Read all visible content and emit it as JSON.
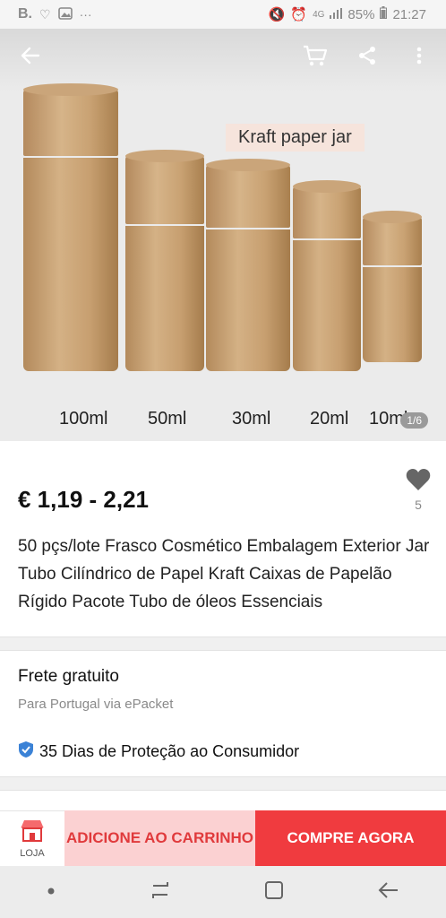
{
  "status_bar": {
    "carrier_mark": "B.",
    "battery": "85%",
    "time": "21:27",
    "network": "4G"
  },
  "hero": {
    "label": "Kraft paper jar",
    "volumes": [
      "100ml",
      "50ml",
      "30ml",
      "20ml",
      "10ml"
    ],
    "pager": "1/6"
  },
  "product": {
    "price": "€ 1,19 - 2,21",
    "wishlist_count": "5",
    "title": "50 pçs/lote Frasco Cosmético Embalagem Exterior Jar Tubo Cilíndrico de Papel Kraft Caixas de Papelão Rígido Pacote Tubo de óleos Essenciais"
  },
  "shipping": {
    "title": "Frete gratuito",
    "subtitle": "Para Portugal via ePacket",
    "protection": "35 Dias de Proteção ao Consumidor"
  },
  "actions": {
    "store_label": "LOJA",
    "add_to_cart": "ADICIONE AO CARRINHO",
    "buy_now": "COMPRE AGORA"
  },
  "colors": {
    "accent_red": "#f03b3f",
    "cart_bg": "#fbd1d2"
  }
}
